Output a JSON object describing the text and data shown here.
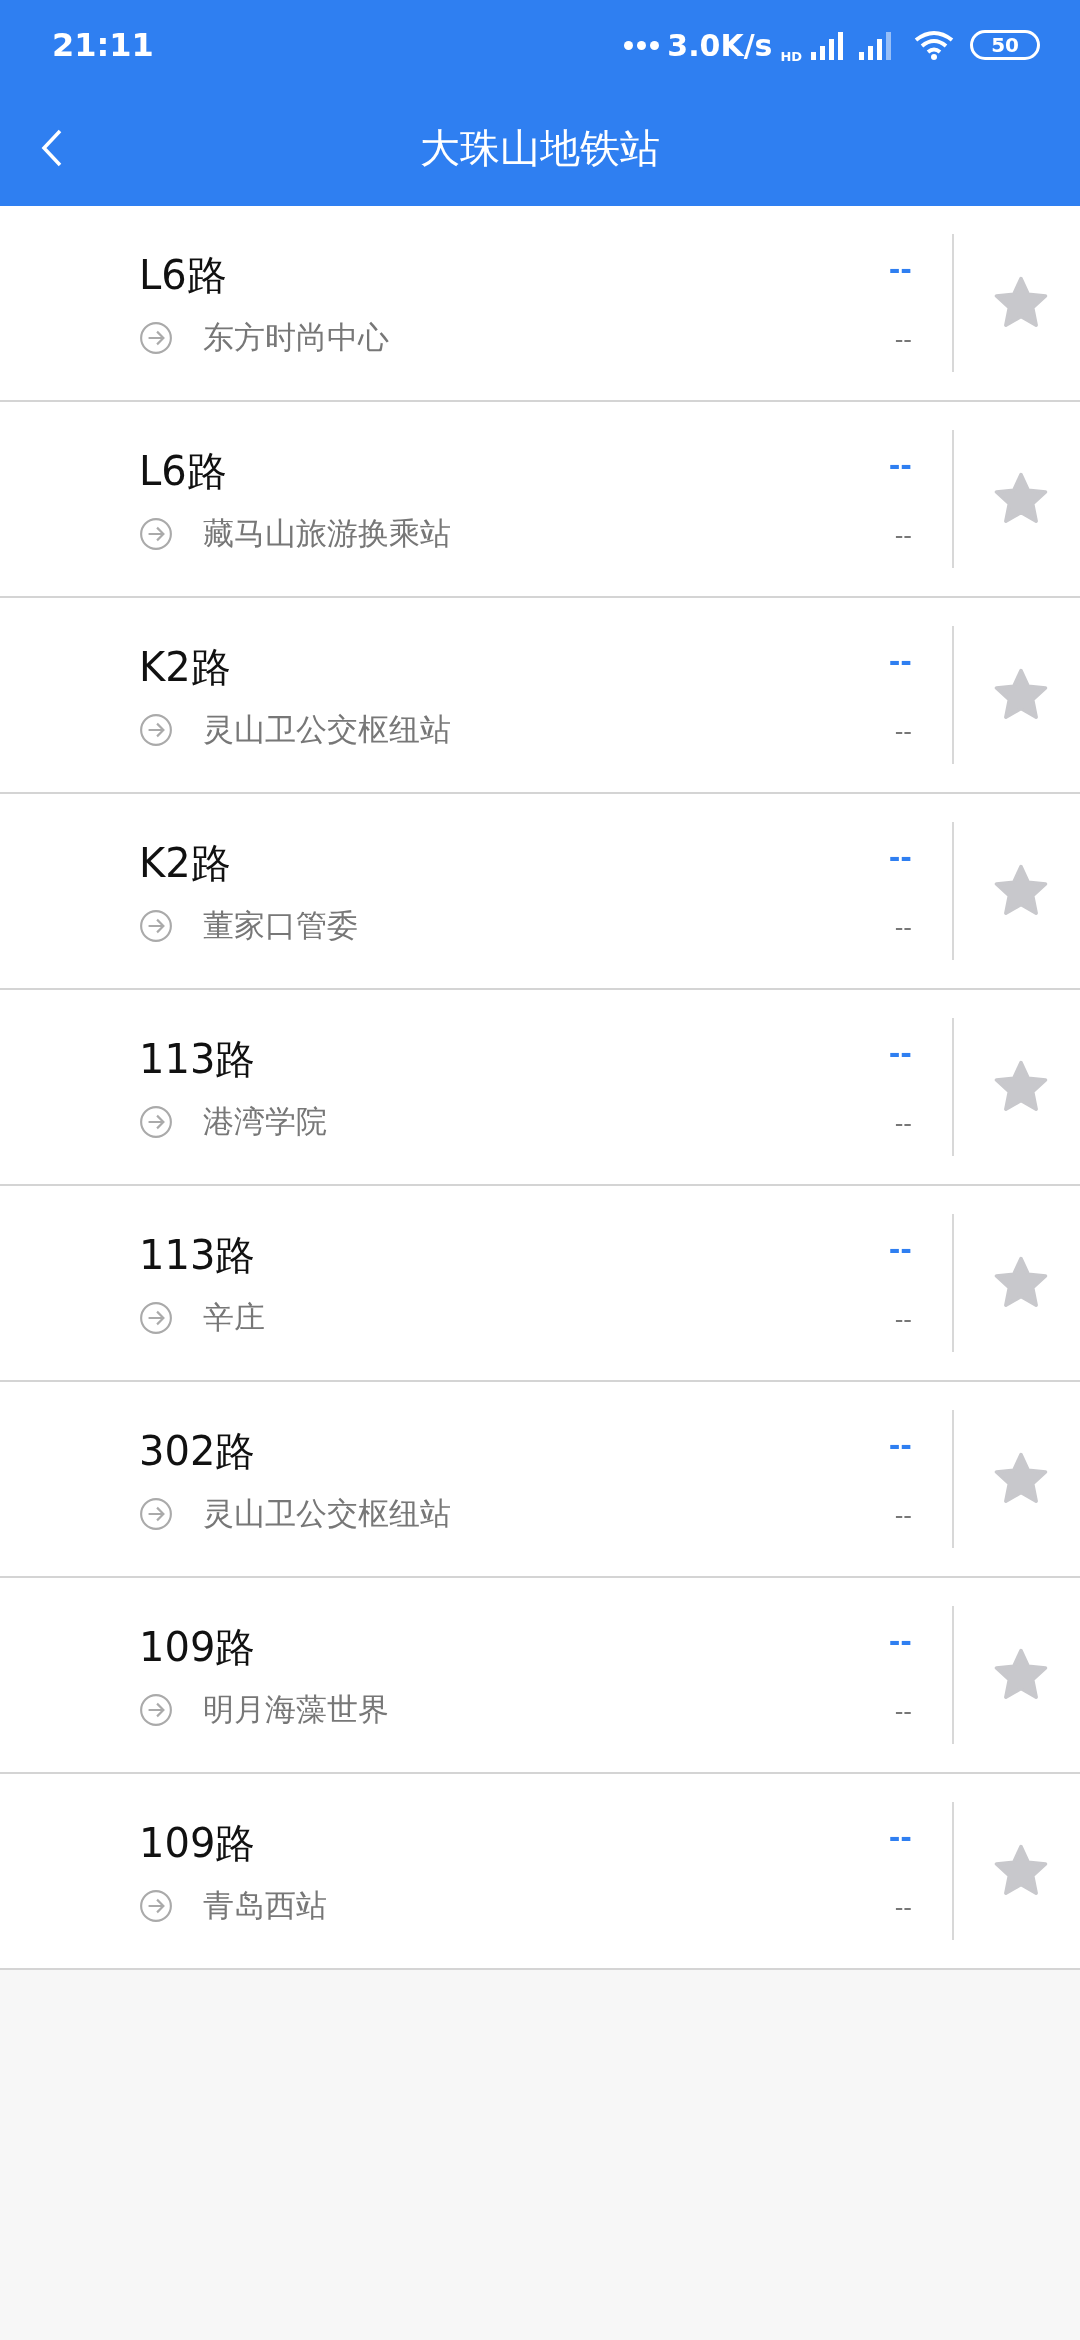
{
  "status_bar": {
    "time": "21:11",
    "speed": "3.0K/s",
    "network": "HD",
    "battery": "50"
  },
  "app_bar": {
    "title": "大珠山地铁站"
  },
  "routes": [
    {
      "name": "L6路",
      "destination": "东方时尚中心",
      "eta": "--",
      "distance": "--",
      "favorite": false
    },
    {
      "name": "L6路",
      "destination": "藏马山旅游换乘站",
      "eta": "--",
      "distance": "--",
      "favorite": false
    },
    {
      "name": "K2路",
      "destination": "灵山卫公交枢纽站",
      "eta": "--",
      "distance": "--",
      "favorite": false
    },
    {
      "name": "K2路",
      "destination": "董家口管委",
      "eta": "--",
      "distance": "--",
      "favorite": false
    },
    {
      "name": "113路",
      "destination": "港湾学院",
      "eta": "--",
      "distance": "--",
      "favorite": false
    },
    {
      "name": "113路",
      "destination": "辛庄",
      "eta": "--",
      "distance": "--",
      "favorite": false
    },
    {
      "name": "302路",
      "destination": "灵山卫公交枢纽站",
      "eta": "--",
      "distance": "--",
      "favorite": false
    },
    {
      "name": "109路",
      "destination": "明月海藻世界",
      "eta": "--",
      "distance": "--",
      "favorite": false
    },
    {
      "name": "109路",
      "destination": "青岛西站",
      "eta": "--",
      "distance": "--",
      "favorite": false
    }
  ]
}
